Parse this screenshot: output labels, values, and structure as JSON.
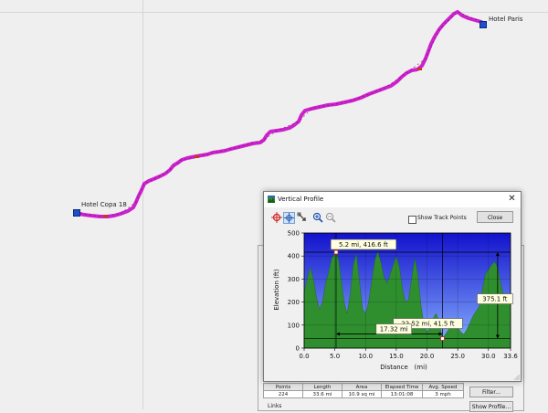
{
  "map": {
    "waypoint_start": "Hotel Copa 18",
    "waypoint_end": "Hotel Paris",
    "track_color": "#cc22cc",
    "background": "#efefef"
  },
  "window": {
    "title": "Vertical Profile",
    "show_track_points_label": "Show Track Points",
    "close_label": "Close"
  },
  "chart_data": {
    "type": "area",
    "xlabel": "Distance   (mi)",
    "ylabel": "Elevation (ft)",
    "xlim": [
      0,
      33.6
    ],
    "ylim": [
      0,
      500
    ],
    "xticks": [
      "0.0",
      "5.0",
      "10.0",
      "15.0",
      "20.0",
      "25.0",
      "30.0",
      "33.6"
    ],
    "yticks": [
      "0",
      "100",
      "200",
      "300",
      "400",
      "500"
    ],
    "fill_color": "#2f8f2f",
    "sky_top": "#1212cc",
    "sky_bottom": "#8ab4ff",
    "series": [
      {
        "x": [
          0,
          0.5,
          1.0,
          1.5,
          2.0,
          2.5,
          3.0,
          3.5,
          4.0,
          4.5,
          5.0,
          5.2,
          5.6,
          6.0,
          6.5,
          7.0,
          7.5,
          8.0,
          8.5,
          9.0,
          9.5,
          10.0,
          10.5,
          11.0,
          11.5,
          12.0,
          12.5,
          13.0,
          13.5,
          14.0,
          14.5,
          15.0,
          15.5,
          16.0,
          16.5,
          17.0,
          17.5,
          18.0,
          18.5,
          19.0,
          19.5,
          20.0,
          20.5,
          21.0,
          21.5,
          22.0,
          22.52,
          23.0,
          23.5,
          24.0,
          24.5,
          25.0,
          25.5,
          26.0,
          26.5,
          27.0,
          27.5,
          28.0,
          28.5,
          29.0,
          29.5,
          30.0,
          30.5,
          31.0,
          31.5,
          32.0,
          32.5,
          33.0,
          33.6
        ],
        "y": [
          240,
          300,
          350,
          300,
          220,
          170,
          200,
          280,
          330,
          390,
          410,
          416.6,
          380,
          300,
          200,
          150,
          230,
          360,
          410,
          290,
          170,
          150,
          200,
          290,
          380,
          420,
          370,
          310,
          280,
          320,
          360,
          400,
          350,
          260,
          200,
          210,
          300,
          390,
          320,
          190,
          100,
          70,
          90,
          130,
          150,
          110,
          41.5,
          60,
          80,
          100,
          110,
          90,
          70,
          60,
          80,
          110,
          140,
          160,
          180,
          250,
          320,
          340,
          360,
          375.1,
          350,
          280,
          220,
          200,
          190
        ]
      }
    ],
    "annotations": [
      {
        "label": "5.2 mi, 416.6 ft",
        "x": 5.2,
        "y": 416.6
      },
      {
        "label": "22.52 mi, 41.5 ft",
        "x": 22.52,
        "y": 41.5
      },
      {
        "label": "17.32 mi",
        "x_start": 5.2,
        "x_end": 22.52
      },
      {
        "label": "375.1 ft",
        "y_start": 41.5,
        "y_end": 416.6
      }
    ]
  },
  "stats": {
    "headers": [
      "Points",
      "Length",
      "Area",
      "Elapsed Time",
      "Avg. Speed"
    ],
    "values": [
      "224",
      "33.6 mi",
      "10.9 sq mi",
      "13:01:08",
      "3 mph"
    ]
  },
  "buttons": {
    "filter": "Filter...",
    "show_profile": "Show Profile..."
  },
  "links_label": "Links"
}
